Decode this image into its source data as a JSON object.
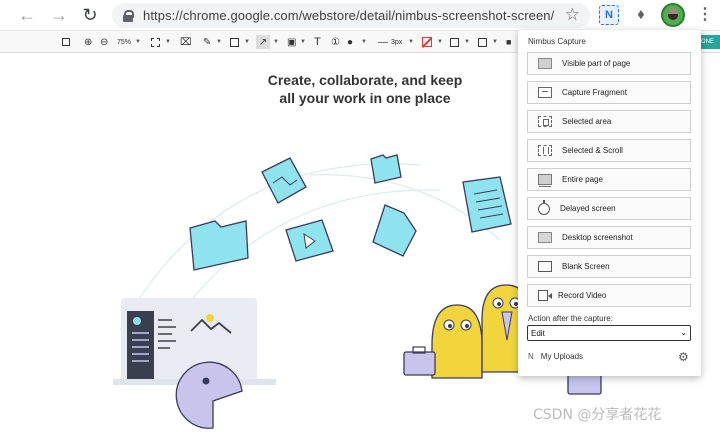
{
  "browser": {
    "url": "https://chrome.google.com/webstore/detail/nimbus-screenshot-screen/",
    "extension_badge": "N"
  },
  "toolbar": {
    "zoom": "75%",
    "stroke": "3px",
    "done_label": "ONE"
  },
  "page": {
    "headline_line1": "Create, collaborate, and keep",
    "headline_line2": "all your work in one place"
  },
  "popup": {
    "title": "Nimbus Capture",
    "items": [
      {
        "label": "Visible part of page",
        "icon": "visible-page-icon"
      },
      {
        "label": "Capture Fragment",
        "icon": "fragment-icon"
      },
      {
        "label": "Selected area",
        "icon": "selected-area-icon"
      },
      {
        "label": "Selected & Scroll",
        "icon": "selected-scroll-icon"
      },
      {
        "label": "Entire page",
        "icon": "entire-page-icon"
      },
      {
        "label": "Delayed screen",
        "icon": "timer-icon"
      },
      {
        "label": "Desktop screenshot",
        "icon": "desktop-icon"
      },
      {
        "label": "Blank Screen",
        "icon": "blank-screen-icon"
      },
      {
        "label": "Record Video",
        "icon": "video-camera-icon"
      }
    ],
    "after_capture_label": "Action after the capture:",
    "after_capture_value": "Edit",
    "uploads_logo": "N",
    "uploads_label": "My Uploads"
  },
  "watermark": "CSDN @分享者花花",
  "colors": {
    "accent": "#1a73e8",
    "illustration_blue": "#8ee3ef",
    "illustration_yellow": "#f2d53c",
    "illustration_purple": "#c9c4ec"
  }
}
